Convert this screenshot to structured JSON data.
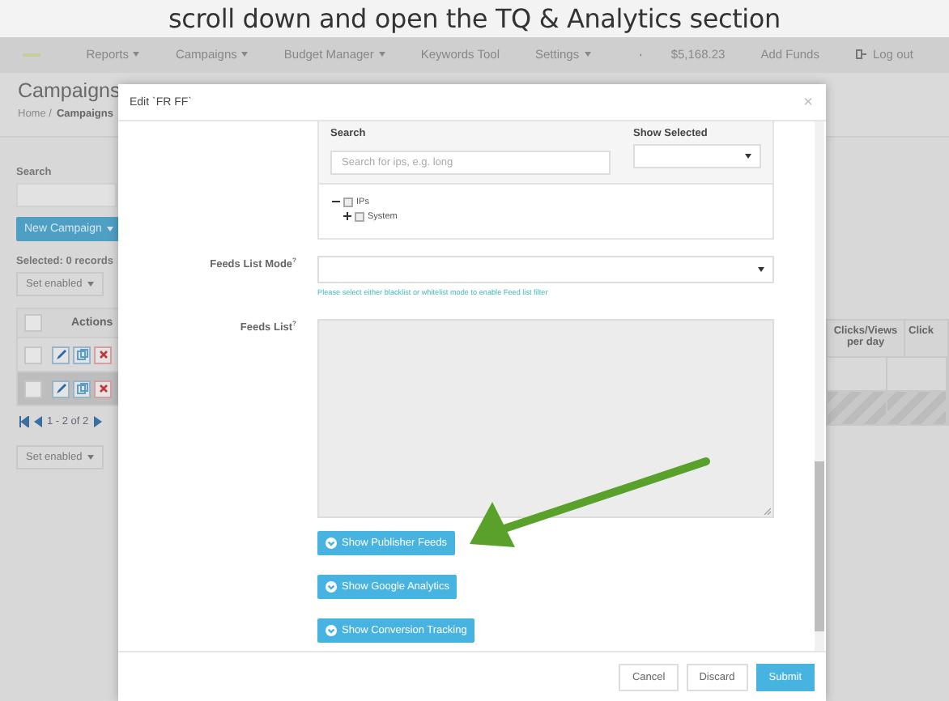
{
  "caption": "scroll down and open the TQ & Analytics section",
  "navbar": {
    "items": [
      {
        "label": "Reports",
        "dropdown": true
      },
      {
        "label": "Campaigns",
        "dropdown": true
      },
      {
        "label": "Budget Manager",
        "dropdown": true
      },
      {
        "label": "Keywords Tool",
        "dropdown": false
      },
      {
        "label": "Settings",
        "dropdown": true
      }
    ],
    "balance": "$5,168.23",
    "add_funds": "Add Funds",
    "logout": "Log out"
  },
  "page": {
    "title": "Campaigns",
    "breadcrumb": [
      "Home /",
      "Campaigns"
    ],
    "search_label": "Search",
    "new_campaign": "New Campaign",
    "selected_info": "Selected: 0 records",
    "bulk_action": "Set enabled",
    "table": {
      "select_all_checked": false,
      "columns": [
        "Actions",
        "Clicks/Views per day",
        "Click"
      ],
      "rows": [
        {
          "selected": false,
          "checked": false
        },
        {
          "selected": true,
          "checked": false
        }
      ]
    },
    "pagination": "1 - 2 of 2",
    "bulk_action_bottom": "Set enabled"
  },
  "modal": {
    "title": "Edit `FR FF`",
    "close": "×",
    "ip_filter": {
      "search_label": "Search",
      "search_placeholder": "Search for ips, e.g. long",
      "show_selected_label": "Show Selected",
      "tree": [
        {
          "label": "IPs",
          "expanded": true,
          "checked": false,
          "children": [
            {
              "label": "System",
              "expanded": false,
              "checked": false
            }
          ]
        }
      ]
    },
    "feeds_list_mode": {
      "label": "Feeds List Mode$^{?}$",
      "help": "Please select either blacklist or whitelist mode to enable Feed list filter"
    },
    "feeds_list": {
      "label": "Feeds List$^{?}$"
    },
    "sections": [
      "Show Publisher Feeds",
      "Show Google Analytics",
      "Show Conversion Tracking"
    ],
    "footer": [
      {
        "label": "Cancel",
        "kind": "default"
      },
      {
        "label": "Discard",
        "kind": "default"
      },
      {
        "label": "Submit",
        "kind": "primary"
      }
    ]
  }
}
